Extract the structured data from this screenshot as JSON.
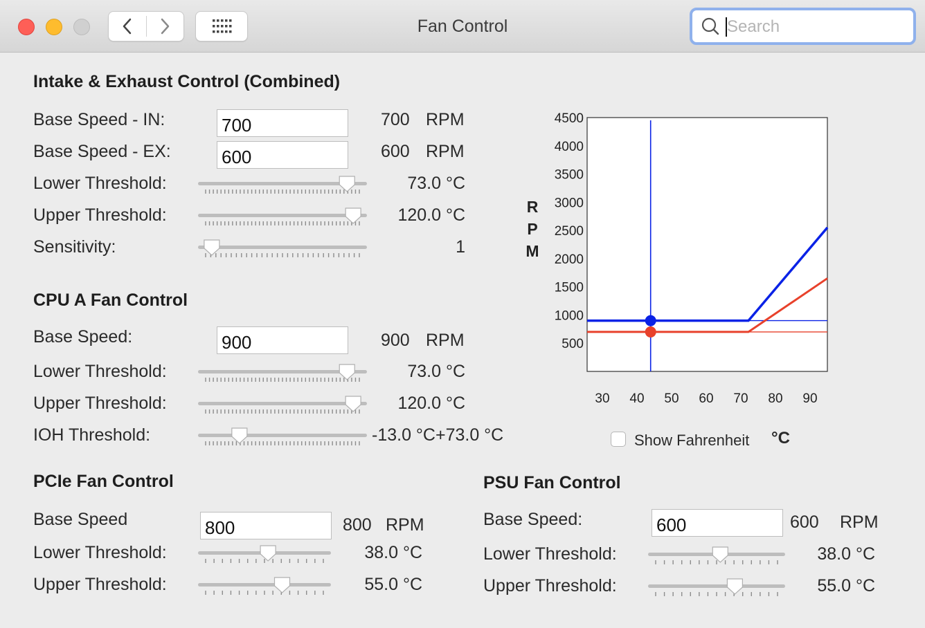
{
  "window": {
    "title": "Fan Control"
  },
  "search": {
    "placeholder": "Search"
  },
  "icons": {
    "back": "chevron-left-icon",
    "forward": "chevron-right-icon",
    "grid": "grid-icon",
    "search": "search-icon"
  },
  "combined": {
    "title": "Intake & Exhaust Control (Combined)",
    "base_in": {
      "label": "Base Speed - IN:",
      "field": "700",
      "value": "700",
      "unit": "RPM"
    },
    "base_ex": {
      "label": "Base Speed - EX:",
      "field": "600",
      "value": "600",
      "unit": "RPM"
    },
    "lower": {
      "label": "Lower Threshold:",
      "value": "73.0 °C",
      "level": 0.92
    },
    "upper": {
      "label": "Upper Threshold:",
      "value": "120.0 °C",
      "level": 0.96
    },
    "sensitivity": {
      "label": "Sensitivity:",
      "value": "1",
      "level": 0.04
    }
  },
  "cpu": {
    "title": "CPU A Fan Control",
    "base": {
      "label": "Base Speed:",
      "field": "900",
      "value": "900",
      "unit": "RPM"
    },
    "lower": {
      "label": "Lower Threshold:",
      "value": "73.0 °C",
      "level": 0.92
    },
    "upper": {
      "label": "Upper Threshold:",
      "value": "120.0 °C",
      "level": 0.96
    },
    "ioh": {
      "label": "IOH Threshold:",
      "value": "-13.0 °C+73.0 °C",
      "level": 0.22
    }
  },
  "pcie": {
    "title": "PCIe Fan Control",
    "base": {
      "label": "Base Speed",
      "field": "800",
      "value": "800",
      "unit": "RPM"
    },
    "lower": {
      "label": "Lower Threshold:",
      "value": "38.0 °C",
      "level": 0.53
    },
    "upper": {
      "label": "Upper Threshold:",
      "value": "55.0 °C",
      "level": 0.65
    }
  },
  "psu": {
    "title": "PSU Fan Control",
    "base": {
      "label": "Base Speed:",
      "field": "600",
      "value": "600",
      "unit": "RPM"
    },
    "lower": {
      "label": "Lower Threshold:",
      "value": "38.0 °C",
      "level": 0.53
    },
    "upper": {
      "label": "Upper Threshold:",
      "value": "55.0 °C",
      "level": 0.65
    }
  },
  "fahrenheit": {
    "label": "Show Fahrenheit",
    "unit": "°C",
    "checked": false
  },
  "chart_data": {
    "type": "line",
    "ylabel": "RPM",
    "xlabel": "°C",
    "y_ticks": [
      500,
      1000,
      1500,
      2000,
      2500,
      3000,
      3500,
      4000,
      4500
    ],
    "x_ticks": [
      30,
      40,
      50,
      60,
      70,
      80,
      90
    ],
    "xlim": [
      26,
      96
    ],
    "ylim": [
      0,
      4500
    ],
    "current_temp": 44.5,
    "series": [
      {
        "color": "#0a22e6",
        "x": [
          26,
          73,
          96
        ],
        "y": [
          900,
          900,
          2550
        ],
        "marker_y": 900
      },
      {
        "color": "#e8412b",
        "x": [
          26,
          73,
          96
        ],
        "y": [
          700,
          700,
          1650
        ],
        "marker_y": 700
      }
    ]
  }
}
